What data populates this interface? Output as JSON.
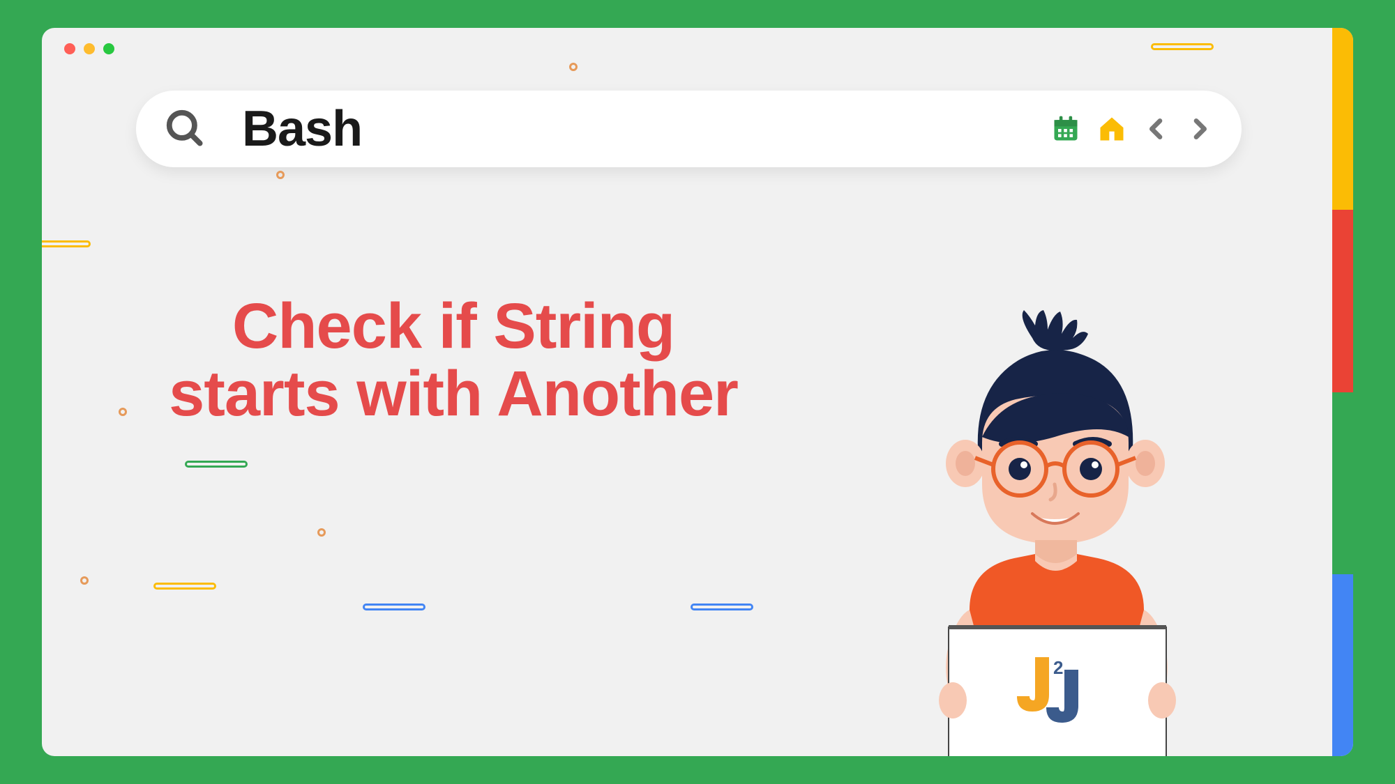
{
  "search": {
    "query": "Bash"
  },
  "headline": "Check if String starts with Another",
  "logo": {
    "text": "J²J"
  },
  "colors": {
    "green": "#34a853",
    "red": "#ea4335",
    "yellow": "#fbbc05",
    "blue": "#4285f4",
    "headline": "#e54b4b"
  }
}
